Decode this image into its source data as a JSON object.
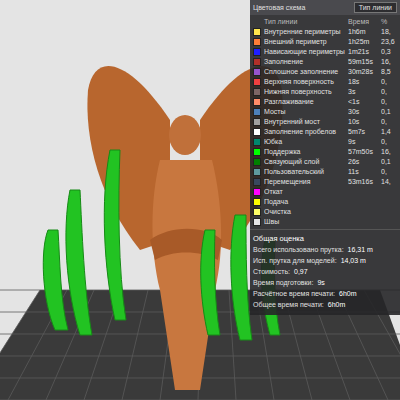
{
  "legend": {
    "title": "Цветовая схема",
    "scheme": "Тип линии",
    "columns": [
      "Тип линии",
      "Время",
      "%"
    ],
    "rows": [
      {
        "name": "Внутренние периметры",
        "time": "1h6m",
        "percent": "18,",
        "color": "#ffe64d"
      },
      {
        "name": "Внешний периметр",
        "time": "1h25m",
        "percent": "23,6",
        "color": "#ff7d38"
      },
      {
        "name": "Нависающие периметры",
        "time": "1m21s",
        "percent": "0,3",
        "color": "#1f1fff"
      },
      {
        "name": "Заполнение",
        "time": "59m15s",
        "percent": "16,",
        "color": "#b03029"
      },
      {
        "name": "Сплошное заполнение",
        "time": "30m28s",
        "percent": "8,5",
        "color": "#9654cc"
      },
      {
        "name": "Верхняя поверхность",
        "time": "18s",
        "percent": "0,",
        "color": "#f04040"
      },
      {
        "name": "Нижняя поверхность",
        "time": "3s",
        "percent": "0,",
        "color": "#7d6666"
      },
      {
        "name": "Разглаживание",
        "time": "<1s",
        "percent": "0,",
        "color": "#ff8c69"
      },
      {
        "name": "Мосты",
        "time": "30s",
        "percent": "0,1",
        "color": "#4d80ba"
      },
      {
        "name": "Внутренний мост",
        "time": "10s",
        "percent": "0,",
        "color": "#a0a0a0"
      },
      {
        "name": "Заполнение пробелов",
        "time": "5m7s",
        "percent": "1,4",
        "color": "#ffffff"
      },
      {
        "name": "Юбка",
        "time": "9s",
        "percent": "0,",
        "color": "#00876e"
      },
      {
        "name": "Поддержка",
        "time": "57m50s",
        "percent": "16,",
        "color": "#00ff00"
      },
      {
        "name": "Связующий слой",
        "time": "26s",
        "percent": "0,1",
        "color": "#008000"
      },
      {
        "name": "Пользовательский",
        "time": "11s",
        "percent": "0,",
        "color": "#5e9a9e"
      },
      {
        "name": "Перемещения",
        "time": "53m16s",
        "percent": "14,",
        "color": "#38485e"
      },
      {
        "name": "Откат",
        "color": "#ff00ff"
      },
      {
        "name": "Подача",
        "color": "#ffff00"
      },
      {
        "name": "Очистка",
        "color": "#ffff66"
      },
      {
        "name": "Швы",
        "color": "#e6e6e6"
      }
    ]
  },
  "summary": {
    "title": "Общая оценка",
    "rows": [
      {
        "label": "Всего использовано прутка:",
        "value": "16,31 m"
      },
      {
        "label": "Исп. прутка для моделей:",
        "value": "14,03 m"
      },
      {
        "label": "Стоимость:",
        "value": "0,97"
      },
      {
        "label": "Время подготовки:",
        "value": "9s"
      },
      {
        "label": "Расчётное время печати:",
        "value": "6h0m"
      },
      {
        "label": "Общее время печати:",
        "value": "6h0m"
      }
    ]
  }
}
